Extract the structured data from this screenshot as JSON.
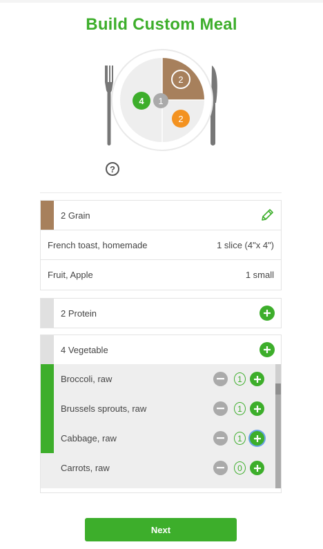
{
  "page_title": "Build Custom Meal",
  "plate": {
    "grain_count": "2",
    "vegetable_count": "4",
    "center_count": "1",
    "protein_count": "2",
    "colors": {
      "grain": "#a7805c",
      "vegetable": "#3dae2b",
      "protein": "#f39220",
      "center": "#aaaaaa"
    }
  },
  "help_glyph": "?",
  "grain": {
    "label": "2 Grain",
    "color": "#a7805c",
    "action_icon": "pencil-icon",
    "items": [
      {
        "name": "French toast, homemade",
        "amount": "1 slice (4\"x 4\")"
      },
      {
        "name": "Fruit, Apple",
        "amount": "1 small"
      }
    ]
  },
  "protein": {
    "label": "2 Protein",
    "action_icon": "plus-icon"
  },
  "vegetable": {
    "label": "4 Vegetable",
    "color": "#3dae2b",
    "action_icon": "plus-icon",
    "items": [
      {
        "name": "Broccoli, raw",
        "qty": "1",
        "selected": true
      },
      {
        "name": "Brussels sprouts, raw",
        "qty": "1",
        "selected": true
      },
      {
        "name": "Cabbage, raw",
        "qty": "1",
        "selected": true
      },
      {
        "name": "Carrots, raw",
        "qty": "0",
        "selected": false
      }
    ]
  },
  "next_label": "Next"
}
